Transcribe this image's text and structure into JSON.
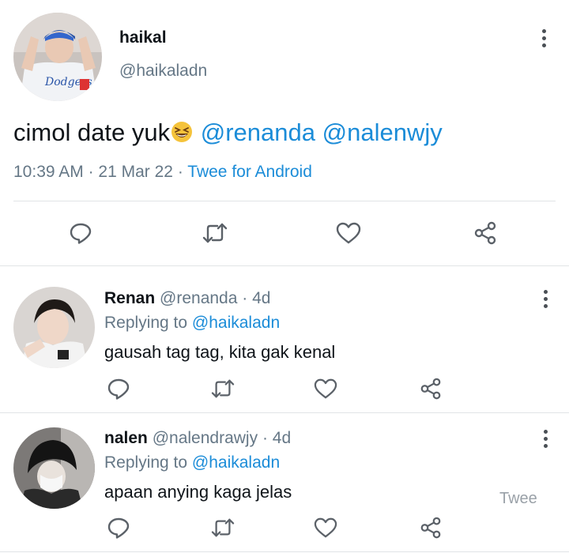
{
  "main_tweet": {
    "author": {
      "name": "haikal",
      "handle": "@haikaladn"
    },
    "text_prefix": "cimol date yuk",
    "emoji_icon": "grinning-squinting-face-emoji",
    "mentions": [
      "@renanda",
      "@nalenwjy"
    ],
    "time": "10:39 AM",
    "date": "21 Mar 22",
    "client": "Twee for Android",
    "separator": "·",
    "actions": [
      "reply-icon",
      "retweet-icon",
      "like-icon",
      "share-icon"
    ]
  },
  "replies": [
    {
      "name": "Renan",
      "handle": "@renanda",
      "age": "4d",
      "replying_label": "Replying to",
      "replying_to": "@haikaladn",
      "text": "gausah tag tag, kita gak kenal"
    },
    {
      "name": "nalen",
      "handle": "@nalendrawjy",
      "age": "4d",
      "replying_label": "Replying to",
      "replying_to": "@haikaladn",
      "text": "apaan anying kaga jelas"
    }
  ],
  "watermark": "Twee",
  "colors": {
    "link": "#1b8cd8",
    "secondary_text": "#657786",
    "primary_text": "#0f1419",
    "icon": "#5b6168",
    "divider": "#e1e4e6"
  }
}
